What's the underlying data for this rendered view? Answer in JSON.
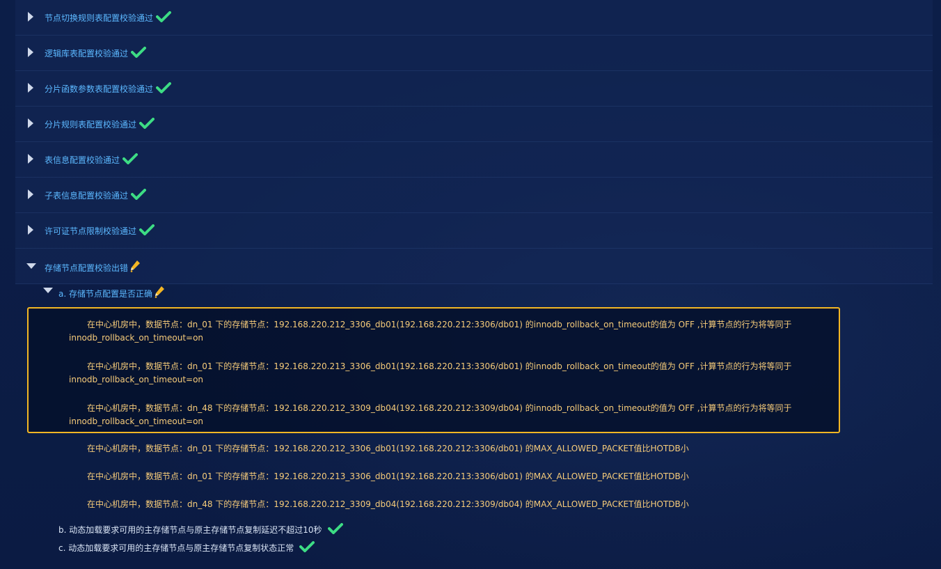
{
  "sections": [
    {
      "label": "节点切换规则表配置校验通过",
      "status": "ok"
    },
    {
      "label": "逻辑库表配置校验通过",
      "status": "ok"
    },
    {
      "label": "分片函数参数表配置校验通过",
      "status": "ok"
    },
    {
      "label": "分片规则表配置校验通过",
      "status": "ok"
    },
    {
      "label": "表信息配置校验通过",
      "status": "ok"
    },
    {
      "label": "子表信息配置校验通过",
      "status": "ok"
    },
    {
      "label": "许可证节点限制校验通过",
      "status": "ok"
    },
    {
      "label": "存储节点配置校验出错",
      "status": "error",
      "expanded": true
    }
  ],
  "subitems": {
    "a": {
      "label": "a. 存储节点配置是否正确",
      "status": "warning",
      "expanded": true
    },
    "b": {
      "label": "b. 动态加载要求可用的主存储节点与原主存储节点复制延迟不超过10秒",
      "status": "ok"
    },
    "c": {
      "label": "c. 动态加载要求可用的主存储节点与原主存储节点复制状态正常",
      "status": "ok"
    }
  },
  "highlighted_errors": [
    {
      "line1": "在中心机房中，数据节点：dn_01 下的存储节点：192.168.220.212_3306_db01(192.168.220.212:3306/db01) 的innodb_rollback_on_timeout的值为 OFF ,计算节点的行为将等同于",
      "line2": "innodb_rollback_on_timeout=on"
    },
    {
      "line1": "在中心机房中，数据节点：dn_01 下的存储节点：192.168.220.213_3306_db01(192.168.220.213:3306/db01) 的innodb_rollback_on_timeout的值为 OFF ,计算节点的行为将等同于",
      "line2": "innodb_rollback_on_timeout=on"
    },
    {
      "line1": "在中心机房中，数据节点：dn_48 下的存储节点：192.168.220.212_3309_db04(192.168.220.212:3309/db04) 的innodb_rollback_on_timeout的值为 OFF ,计算节点的行为将等同于",
      "line2": "innodb_rollback_on_timeout=on"
    }
  ],
  "messages": [
    "在中心机房中，数据节点：dn_01 下的存储节点：192.168.220.212_3306_db01(192.168.220.212:3306/db01) 的MAX_ALLOWED_PACKET值比HOTDB小",
    "在中心机房中，数据节点：dn_01 下的存储节点：192.168.220.213_3306_db01(192.168.220.213:3306/db01) 的MAX_ALLOWED_PACKET值比HOTDB小",
    "在中心机房中，数据节点：dn_48 下的存储节点：192.168.220.212_3309_db04(192.168.220.212:3309/db04) 的MAX_ALLOWED_PACKET值比HOTDB小"
  ],
  "colors": {
    "ok": "#3ddc84",
    "warning": "#f3b624",
    "label": "#5cb8ff",
    "message": "#f7cc7a"
  }
}
